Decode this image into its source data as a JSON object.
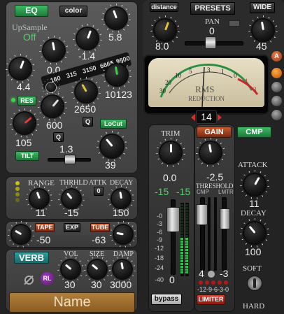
{
  "eq": {
    "eq_btn": "EQ",
    "color_btn": "color",
    "upsample_label": "UpSample",
    "upsample_value": "Off",
    "knob_58": "5.8",
    "knob_n14": "-1.4",
    "knob_00": "0.0",
    "knob_44": "4.4",
    "freq_labels": [
      "160",
      "315",
      "3150",
      "6665",
      "9500"
    ],
    "res_btn": "RES",
    "knob_10123": "10123",
    "knob_2650": "2650",
    "knob_105": "105",
    "knob_600": "600",
    "q_btn_a": "Q",
    "q_btn_b": "Q",
    "locut_btn": "LoCut",
    "tilt_btn": "TILT",
    "tilt_value": "1.3",
    "knob_39": "39"
  },
  "dyn": {
    "range_label": "RANGE",
    "thrhld_label": "THRHLD",
    "attk_label": "ATTK",
    "decay_label": "DECAY",
    "attk_value": "0",
    "range_value": "11",
    "thrhld_value": "-15",
    "decay_value": "150",
    "tape_btn": "TAPE",
    "exp_btn": "EXP",
    "tube_btn": "TUBE",
    "tape_value": "-50",
    "tube_value": "-63"
  },
  "verb": {
    "verb_btn": "VERB",
    "vol_label": "VOL",
    "size_label": "SIZE",
    "damp_label": "DAMP",
    "rl_btn": "RL",
    "vol_value": "30",
    "size_value": "30",
    "damp_value": "3000",
    "name_text": "Name"
  },
  "top": {
    "distance_btn": "distance",
    "presets_btn": "PRESETS",
    "wide_btn": "WIDE",
    "pan_label": "PAN",
    "pan_value": "0",
    "distance_value": "8.0",
    "wide_value": "45",
    "a_btn": "A"
  },
  "meter": {
    "scale": [
      "30",
      "20",
      "10",
      "5",
      "3",
      "1",
      "0",
      "1",
      "3"
    ],
    "title": "RMS",
    "subtitle": "REDUCTION",
    "mode_value": "14"
  },
  "gain": {
    "gain_btn": "GAIN",
    "cmp_btn": "CMP",
    "trim_label": "TRIM",
    "trim_value": "0.0",
    "in_left": "-15",
    "in_right": "-15",
    "scale": [
      "-0",
      "-3",
      "-6",
      "-9",
      "-12",
      "-18",
      "-24",
      "-40"
    ],
    "fader_value": "0",
    "bypass_btn": "bypass"
  },
  "comp": {
    "threshold_value": "-2.5",
    "threshold_label": "THRESHOLD",
    "cmp_label": "CMP",
    "lmtr_label": "LMTR",
    "cmp_value": "4",
    "lmtr_value": "-3",
    "gr_scale": "-12-9-6-3-0",
    "limiter_btn": "LIMITER",
    "attack_label": "ATTACK",
    "attack_value": "11",
    "decay_label": "DECAY",
    "decay_value": "100",
    "soft_label": "SOFT",
    "hard_label": "HARD"
  }
}
